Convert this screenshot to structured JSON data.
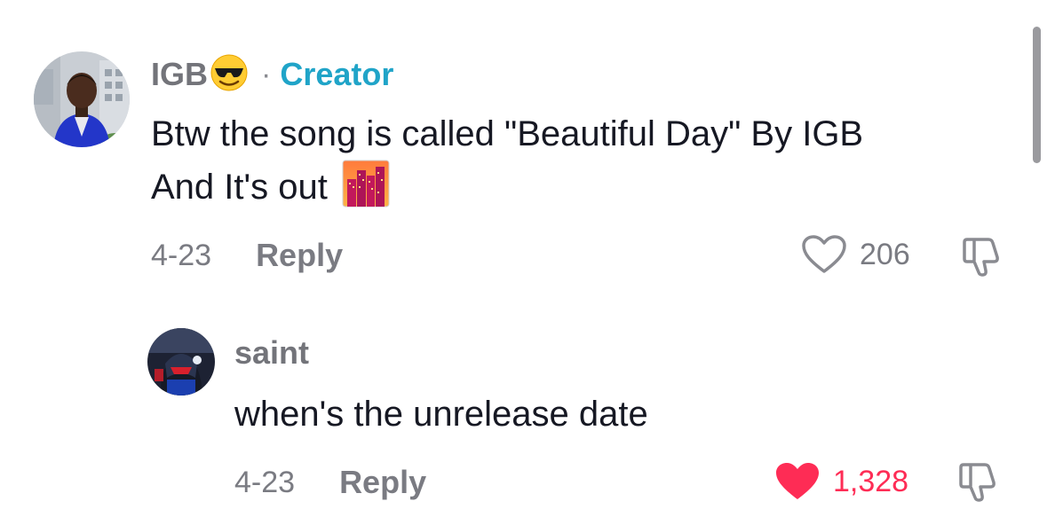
{
  "comments": [
    {
      "username": "IGB",
      "username_emoji": "smiling-face-with-sunglasses",
      "separator": "·",
      "badge": "Creator",
      "text_line1": "Btw the song is called \"Beautiful Day\" By IGB",
      "text_line2": "And It's out",
      "text_emoji": "city-sunset",
      "date": "4-23",
      "reply_label": "Reply",
      "likes": "206",
      "liked": false
    },
    {
      "username": "saint",
      "text": "when's the unrelease date",
      "date": "4-23",
      "reply_label": "Reply",
      "likes": "1,328",
      "liked": true
    }
  ],
  "colors": {
    "like_active": "#fe2c55",
    "creator_badge": "#20a4c8",
    "muted_text": "#7a7b82"
  }
}
